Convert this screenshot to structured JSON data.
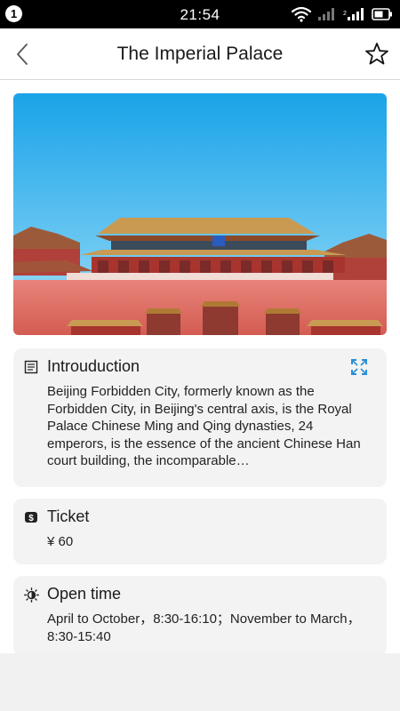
{
  "status_bar": {
    "notification_count": "1",
    "time": "21:54",
    "icons": [
      "wifi-icon",
      "signal-icon",
      "signal-icon",
      "battery-icon"
    ]
  },
  "header": {
    "title": "The Imperial Palace",
    "back_icon": "chevron-left-icon",
    "favorite_icon": "star-outline-icon"
  },
  "hero_image": {
    "subject": "Meridian Gate of the Forbidden City"
  },
  "sections": {
    "introduction": {
      "title": "Introuduction",
      "icon": "document-icon",
      "action_icon": "expand-icon",
      "body": "Beijing Forbidden City, formerly known as the Forbidden City, in Beijing's central axis, is the Royal Palace Chinese Ming and Qing dynasties, 24 emperors, is the essence of the ancient Chinese Han court building, the incomparable…"
    },
    "ticket": {
      "title": "Ticket",
      "icon": "money-icon",
      "body": "¥ 60"
    },
    "open_time": {
      "title": "Open time",
      "icon": "sun-icon",
      "body": "April to October，8:30-16:10；November to March，8:30-15:40"
    }
  },
  "colors": {
    "accent": "#2a8fd8",
    "card_bg": "#f3f3f3",
    "status_bar_bg": "#000000"
  }
}
